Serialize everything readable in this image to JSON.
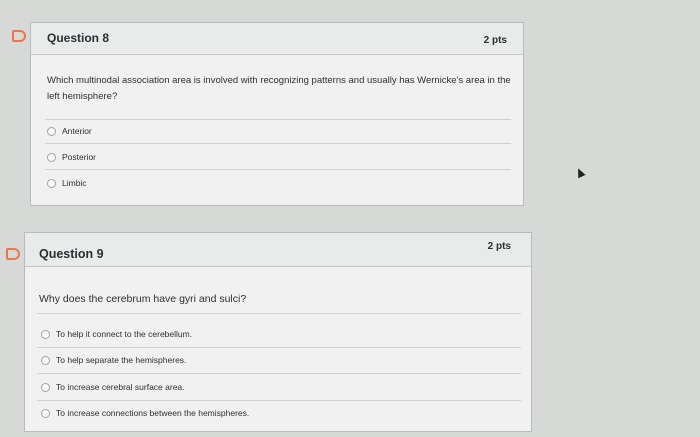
{
  "questions": [
    {
      "title": "Question 8",
      "points": "2 pts",
      "text": "Which multinodal association area is involved with recognizing patterns and usually has Wernicke's area in the left hemisphere?",
      "answers": [
        "Anterior",
        "Posterior",
        "Limbic"
      ]
    },
    {
      "title": "Question 9",
      "points": "2 pts",
      "text": "Why does the cerebrum have gyri and sulci?",
      "answers": [
        "To help it connect to the cerebellum.",
        "To help separate the hemispheres.",
        "To increase cerebral surface area.",
        "To increase connections between the hemispheres."
      ]
    }
  ],
  "colors": {
    "flag": "#e8774b",
    "background": "#d7d9d7",
    "card": "#f0f1f0"
  },
  "icons": {
    "flag": "bookmark-flag-icon",
    "radio": "radio-button-icon",
    "cursor": "mouse-pointer-icon"
  }
}
